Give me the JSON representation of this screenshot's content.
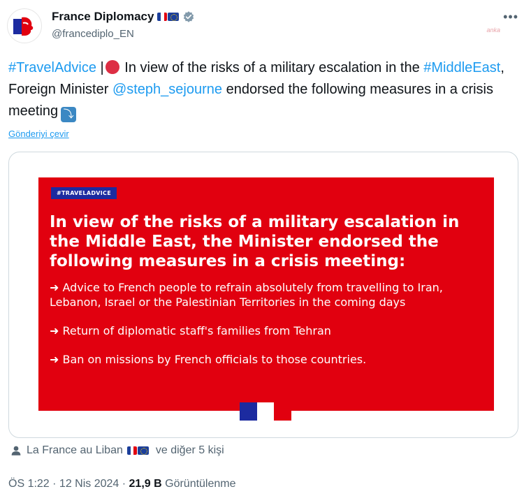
{
  "author": {
    "display_name": "France Diplomacy",
    "handle": "@francediplo_EN",
    "flag_icons": [
      "fr-flag-icon",
      "eu-flag-icon"
    ]
  },
  "watermark": "anka",
  "tweet": {
    "hashtag1": "#TravelAdvice",
    "sep": " |",
    "text1": " In view of the risks of a military escalation in the ",
    "hashtag2": "#MiddleEast",
    "text2": ", Foreign Minister ",
    "mention": "@steph_sejourne",
    "text3": " endorsed the following measures in a crisis meeting",
    "arrow_glyph": "⤵"
  },
  "translate_label": "Gönderiyi çevir",
  "poster": {
    "tag": "#TRAVELADVICE",
    "headline": "In view of the risks of a military escalation in the Middle East, the Minister endorsed the following measures in a crisis meeting:",
    "items": [
      "➜ Advice to French people to refrain absolutely from travelling to Iran, Lebanon, Israel or the Palestinian Territories in the coming days",
      "➜ Return of diplomatic staff's families from Tehran",
      "➜ Ban on missions by French officials to those countries."
    ]
  },
  "reposted_by": {
    "name": "La France au Liban",
    "others": "ve diğer 5 kişi"
  },
  "meta": {
    "time": "ÖS 1:22",
    "dot": " · ",
    "date": "12 Nis 2024",
    "views_count": "21,9 B",
    "views_label": " Görüntülenme"
  },
  "colors": {
    "link": "#1d9bf0",
    "poster_red": "#e1000f",
    "poster_blue": "#1c2ba0",
    "muted": "#536471"
  }
}
